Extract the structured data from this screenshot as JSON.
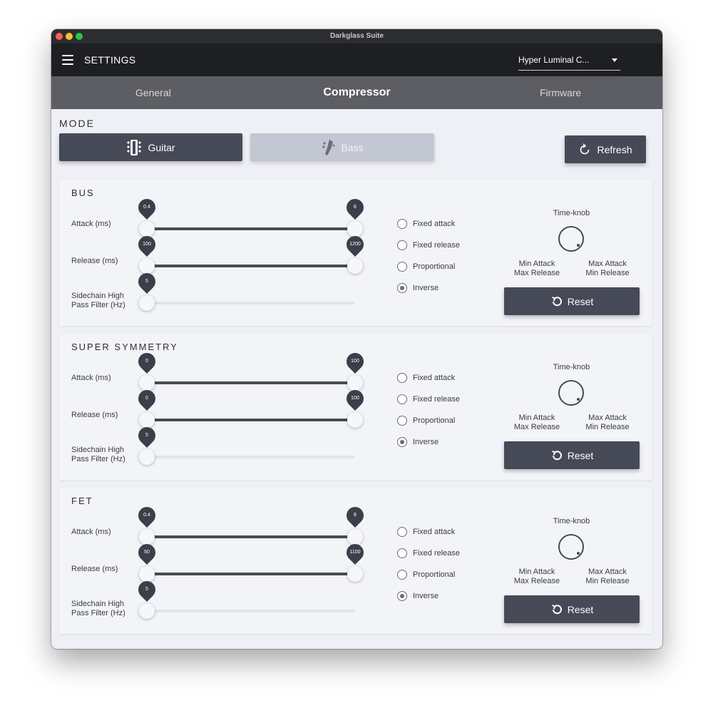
{
  "window": {
    "title": "Darkglass Suite"
  },
  "appbar": {
    "menu_icon": "hamburger-menu-icon",
    "title": "SETTINGS",
    "device_select_value": "Hyper Luminal C..."
  },
  "tabs": [
    {
      "label": "General",
      "active": false
    },
    {
      "label": "Compressor",
      "active": true
    },
    {
      "label": "Firmware",
      "active": false
    }
  ],
  "mode": {
    "label": "MODE",
    "guitar_label": "Guitar",
    "bass_label": "Bass",
    "selected": "Guitar",
    "refresh_label": "Refresh"
  },
  "sections": [
    {
      "title": "BUS",
      "sliders": [
        {
          "label_lines": [
            "Attack (ms)"
          ],
          "low": "0.4",
          "high": "6",
          "low_frac": 0.0,
          "high_frac": 1.0,
          "range": true
        },
        {
          "label_lines": [
            "Release (ms)"
          ],
          "low": "100",
          "high": "1200",
          "low_frac": 0.0,
          "high_frac": 1.0,
          "range": true
        },
        {
          "label_lines": [
            "Sidechain High",
            "Pass Filter (Hz)"
          ],
          "value": "5",
          "value_frac": 0.0,
          "range": false
        }
      ],
      "options": [
        {
          "label": "Fixed attack",
          "checked": false
        },
        {
          "label": "Fixed release",
          "checked": false
        },
        {
          "label": "Proportional",
          "checked": false
        },
        {
          "label": "Inverse",
          "checked": true
        }
      ],
      "knob_title": "Time-knob",
      "knob_min": [
        "Min Attack",
        "Max Release"
      ],
      "knob_max": [
        "Max Attack",
        "Min Release"
      ],
      "reset_label": "Reset"
    },
    {
      "title": "SUPER SYMMETRY",
      "sliders": [
        {
          "label_lines": [
            "Attack (ms)"
          ],
          "low": "0",
          "high": "100",
          "low_frac": 0.0,
          "high_frac": 1.0,
          "range": true
        },
        {
          "label_lines": [
            "Release (ms)"
          ],
          "low": "0",
          "high": "100",
          "low_frac": 0.0,
          "high_frac": 1.0,
          "range": true
        },
        {
          "label_lines": [
            "Sidechain High",
            "Pass Filter (Hz)"
          ],
          "value": "5",
          "value_frac": 0.0,
          "range": false
        }
      ],
      "options": [
        {
          "label": "Fixed attack",
          "checked": false
        },
        {
          "label": "Fixed release",
          "checked": false
        },
        {
          "label": "Proportional",
          "checked": false
        },
        {
          "label": "Inverse",
          "checked": true
        }
      ],
      "knob_title": "Time-knob",
      "knob_min": [
        "Min Attack",
        "Max Release"
      ],
      "knob_max": [
        "Max Attack",
        "Min Release"
      ],
      "reset_label": "Reset"
    },
    {
      "title": "FET",
      "sliders": [
        {
          "label_lines": [
            "Attack (ms)"
          ],
          "low": "0.4",
          "high": "8",
          "low_frac": 0.0,
          "high_frac": 1.0,
          "range": true
        },
        {
          "label_lines": [
            "Release (ms)"
          ],
          "low": "50",
          "high": "1100",
          "low_frac": 0.0,
          "high_frac": 1.0,
          "range": true
        },
        {
          "label_lines": [
            "Sidechain High",
            "Pass Filter (Hz)"
          ],
          "value": "5",
          "value_frac": 0.0,
          "range": false
        }
      ],
      "options": [
        {
          "label": "Fixed attack",
          "checked": false
        },
        {
          "label": "Fixed release",
          "checked": false
        },
        {
          "label": "Proportional",
          "checked": false
        },
        {
          "label": "Inverse",
          "checked": true
        }
      ],
      "knob_title": "Time-knob",
      "knob_min": [
        "Min Attack",
        "Max Release"
      ],
      "knob_max": [
        "Max Attack",
        "Min Release"
      ],
      "reset_label": "Reset"
    }
  ],
  "icons": {
    "guitar": "guitar-headstock-icon",
    "bass": "bass-headstock-icon",
    "refresh": "refresh-icon",
    "reset": "undo-reset-icon"
  }
}
